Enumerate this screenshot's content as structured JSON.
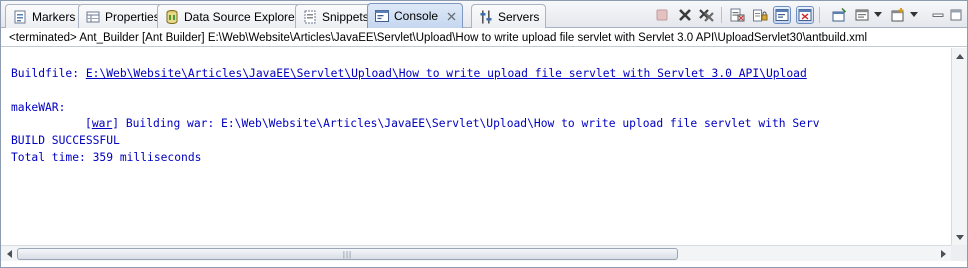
{
  "tabs": [
    {
      "label": "Markers",
      "icon": "markers-icon"
    },
    {
      "label": "Properties",
      "icon": "properties-icon"
    },
    {
      "label": "Data Source Explorer",
      "icon": "data-source-explorer-icon"
    },
    {
      "label": "Snippets",
      "icon": "snippets-icon"
    },
    {
      "label": "Console",
      "icon": "console-icon",
      "active": true
    },
    {
      "label": "Servers",
      "icon": "servers-icon"
    }
  ],
  "status_line": "<terminated> Ant_Builder [Ant Builder] E:\\Web\\Website\\Articles\\JavaEE\\Servlet\\Upload\\How to write upload file servlet with Servlet 3.0 API\\UploadServlet30\\antbuild.xml",
  "console": {
    "buildfile_prefix": "Buildfile: ",
    "buildfile_link": "E:\\Web\\Website\\Articles\\JavaEE\\Servlet\\Upload\\How to write upload file servlet with Servlet 3.0 API\\Upload",
    "target": "makeWAR:",
    "war_tag_open": "[",
    "war_tag": "war",
    "war_tag_close": "]",
    "war_message": " Building war: E:\\Web\\Website\\Articles\\JavaEE\\Servlet\\Upload\\How to write upload file servlet with Serv",
    "result": "BUILD SUCCESSFUL",
    "total_time": "Total time: 359 milliseconds"
  },
  "colors": {
    "console_text": "#0000c0",
    "active_tab": "#c4d6ef",
    "frame_border": "#8d9bb0"
  },
  "toolbar_icons": [
    "terminate-icon",
    "remove-launch-icon",
    "remove-all-terminated-icon",
    "clear-console-icon",
    "scroll-lock-icon",
    "word-wrap-icon",
    "show-console-on-output-icon",
    "pin-console-icon",
    "display-selected-console-icon",
    "display-selected-console-dropdown-icon",
    "open-console-icon",
    "open-console-dropdown-icon",
    "minimize-icon",
    "maximize-icon"
  ]
}
